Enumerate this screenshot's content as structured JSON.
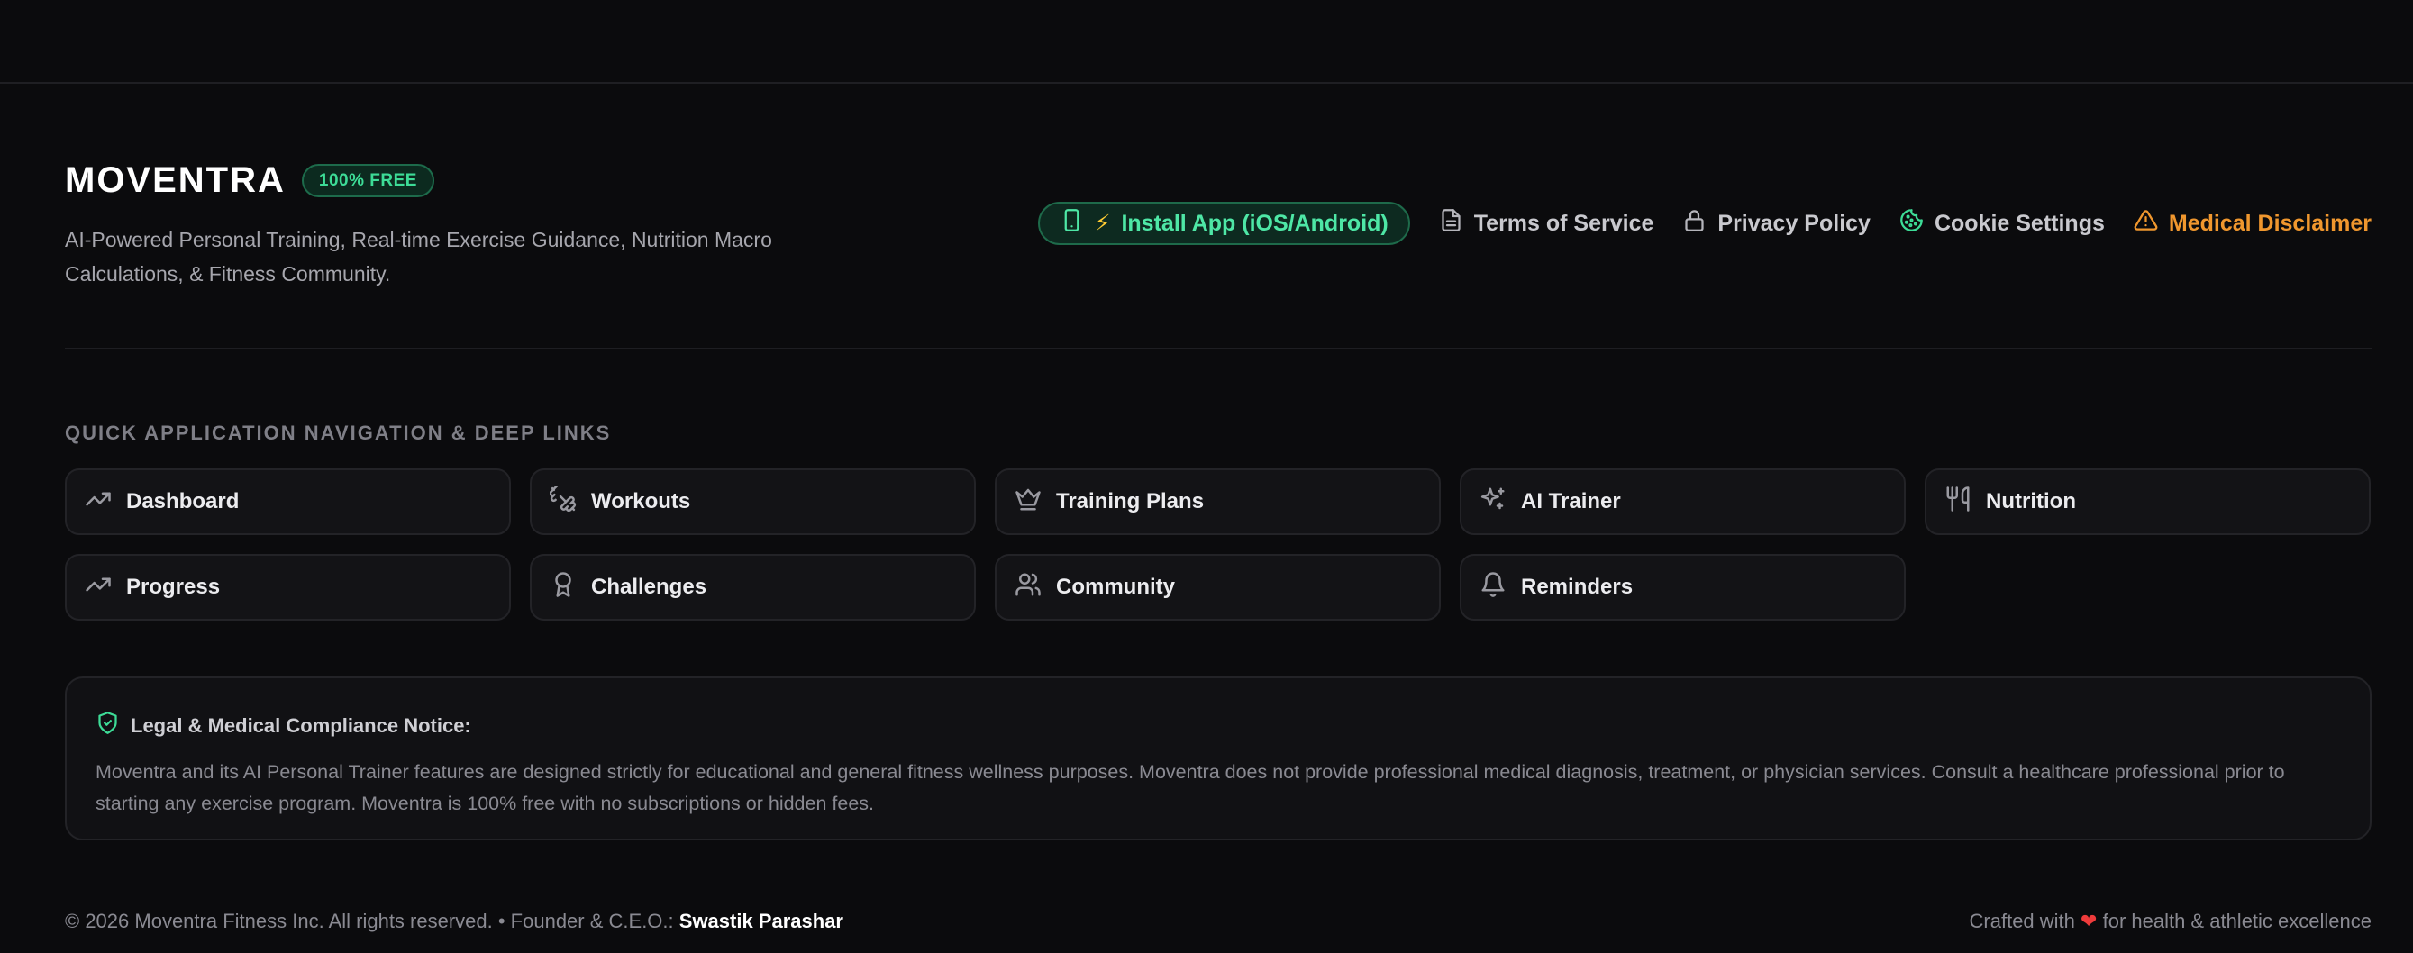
{
  "brand": {
    "name": "MOVENTRA",
    "badge": "100% FREE",
    "tagline": "AI-Powered Personal Training, Real-time Exercise Guidance, Nutrition Macro Calculations, & Fitness Community."
  },
  "top_links": {
    "install": {
      "bolt": "⚡",
      "label": "Install App (iOS/Android)",
      "icon": "smartphone-icon"
    },
    "terms": {
      "label": "Terms of Service",
      "icon": "document-icon"
    },
    "privacy": {
      "label": "Privacy Policy",
      "icon": "lock-icon"
    },
    "cookies": {
      "label": "Cookie Settings",
      "icon": "cookie-icon"
    },
    "disclaimer": {
      "label": "Medical Disclaimer",
      "icon": "warning-icon"
    }
  },
  "quick_nav": {
    "heading": "QUICK APPLICATION NAVIGATION & DEEP LINKS",
    "items": [
      {
        "label": "Dashboard",
        "icon": "trending-up-icon"
      },
      {
        "label": "Workouts",
        "icon": "dumbbell-icon"
      },
      {
        "label": "Training Plans",
        "icon": "crown-icon"
      },
      {
        "label": "AI Trainer",
        "icon": "sparkles-icon"
      },
      {
        "label": "Nutrition",
        "icon": "utensils-icon"
      },
      {
        "label": "Progress",
        "icon": "trending-up-icon"
      },
      {
        "label": "Challenges",
        "icon": "award-icon"
      },
      {
        "label": "Community",
        "icon": "users-icon"
      },
      {
        "label": "Reminders",
        "icon": "bell-icon"
      }
    ]
  },
  "notice": {
    "title": "Legal & Medical Compliance Notice:",
    "body": "Moventra and its AI Personal Trainer features are designed strictly for educational and general fitness wellness purposes. Moventra does not provide professional medical diagnosis, treatment, or physician services. Consult a healthcare professional prior to starting any exercise program. Moventra is 100% free with no subscriptions or hidden fees.",
    "icon": "shield-check-icon"
  },
  "bottom": {
    "copyright": "© 2026 Moventra Fitness Inc. All rights reserved. • Founder & C.E.O.:",
    "founder": "Swastik Parashar",
    "crafted_prefix": "Crafted with",
    "heart": "❤",
    "crafted_suffix": "for health & athletic excellence"
  },
  "colors": {
    "background": "#0b0b0d",
    "accent_green": "#3ddc97",
    "warning_orange": "#f0972e",
    "heart_red": "#ef3b3b"
  }
}
